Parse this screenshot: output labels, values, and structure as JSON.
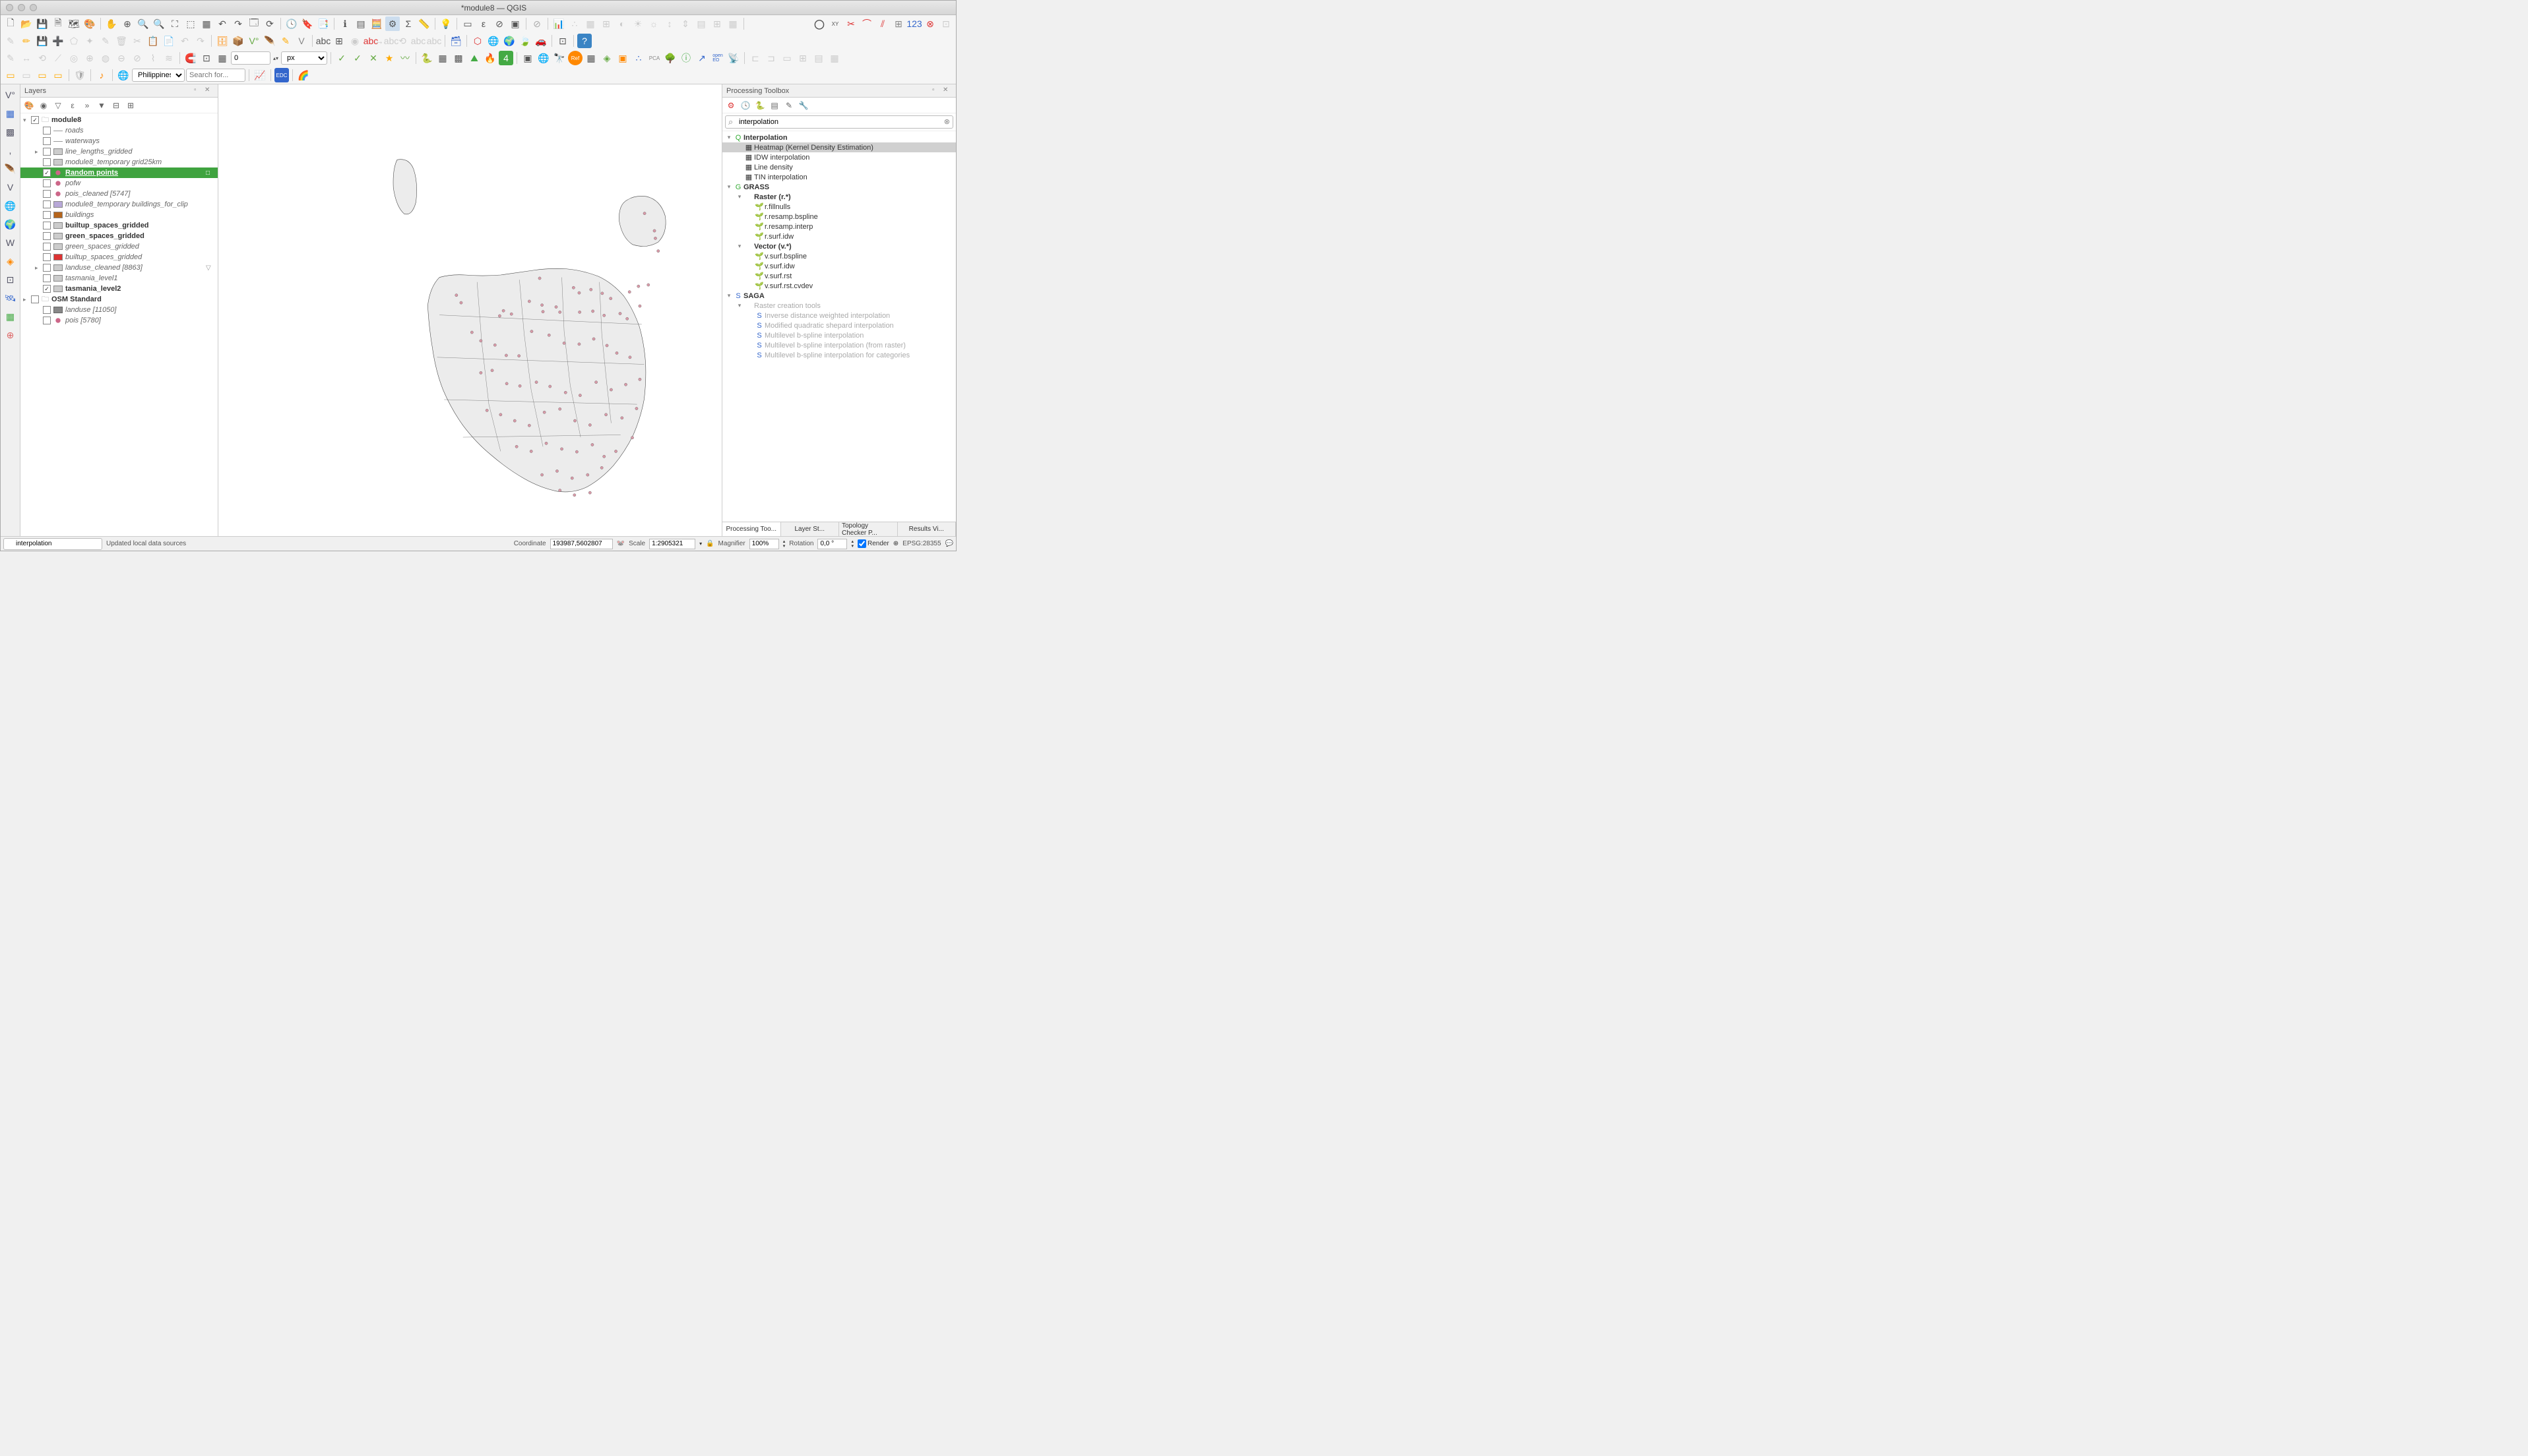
{
  "title": "*module8 — QGIS",
  "toolbar_row3": {
    "spin_value": "0",
    "unit": "px"
  },
  "toolbar_row4": {
    "region": "Philippines",
    "search_placeholder": "Search for..."
  },
  "layers_panel": {
    "title": "Layers",
    "items": [
      {
        "depth": 0,
        "exp": "▾",
        "checked": true,
        "icon": "group",
        "label": "module8",
        "bold": true
      },
      {
        "depth": 1,
        "exp": "",
        "checked": false,
        "icon": "line",
        "label": "roads",
        "italic": true
      },
      {
        "depth": 1,
        "exp": "",
        "checked": false,
        "icon": "line",
        "label": "waterways",
        "italic": true
      },
      {
        "depth": 1,
        "exp": "▸",
        "checked": false,
        "icon": "grid",
        "label": "line_lengths_gridded",
        "italic": true
      },
      {
        "depth": 1,
        "exp": "",
        "checked": false,
        "icon": "grid",
        "label": "module8_temporary grid25km",
        "italic": true
      },
      {
        "depth": 1,
        "exp": "",
        "checked": true,
        "icon": "point",
        "label": "Random points",
        "bold": true,
        "selected": true,
        "end": "□"
      },
      {
        "depth": 1,
        "exp": "",
        "checked": false,
        "icon": "dot",
        "label": "pofw",
        "italic": true
      },
      {
        "depth": 1,
        "exp": "",
        "checked": false,
        "icon": "dot",
        "label": "pois_cleaned [5747]",
        "italic": true
      },
      {
        "depth": 1,
        "exp": "",
        "checked": false,
        "icon": "purple",
        "label": "module8_temporary buildings_for_clip",
        "italic": true
      },
      {
        "depth": 1,
        "exp": "",
        "checked": false,
        "icon": "brown",
        "label": "buildings",
        "italic": true
      },
      {
        "depth": 1,
        "exp": "",
        "checked": false,
        "icon": "table",
        "label": "builtup_spaces_gridded",
        "bold": true
      },
      {
        "depth": 1,
        "exp": "",
        "checked": false,
        "icon": "table",
        "label": "green_spaces_gridded",
        "bold": true
      },
      {
        "depth": 1,
        "exp": "",
        "checked": false,
        "icon": "grid",
        "label": "green_spaces_gridded",
        "italic": true
      },
      {
        "depth": 1,
        "exp": "",
        "checked": false,
        "icon": "red",
        "label": "builtup_spaces_gridded",
        "italic": true
      },
      {
        "depth": 1,
        "exp": "▸",
        "checked": false,
        "icon": "grid",
        "label": "landuse_cleaned [8863]",
        "italic": true,
        "filter": "▽"
      },
      {
        "depth": 1,
        "exp": "",
        "checked": false,
        "icon": "poly",
        "label": "tasmania_level1",
        "italic": true
      },
      {
        "depth": 1,
        "exp": "",
        "checked": true,
        "icon": "poly",
        "label": "tasmania_level2",
        "bold": true
      },
      {
        "depth": 0,
        "exp": "▸",
        "checked": false,
        "icon": "group",
        "label": "OSM Standard",
        "bold": true
      },
      {
        "depth": 1,
        "exp": "",
        "checked": false,
        "icon": "grey",
        "label": "landuse [11050]",
        "italic": true
      },
      {
        "depth": 1,
        "exp": "",
        "checked": false,
        "icon": "dot",
        "label": "pois [5780]",
        "italic": true
      }
    ]
  },
  "processing_panel": {
    "title": "Processing Toolbox",
    "search_value": "interpolation",
    "tree": [
      {
        "depth": 0,
        "exp": "▾",
        "icon": "Q",
        "label": "Interpolation",
        "bold": true,
        "color": "#3a3"
      },
      {
        "depth": 1,
        "exp": "",
        "icon": "▦",
        "label": "Heatmap (Kernel Density Estimation)",
        "selected": true
      },
      {
        "depth": 1,
        "exp": "",
        "icon": "▦",
        "label": "IDW interpolation"
      },
      {
        "depth": 1,
        "exp": "",
        "icon": "▦",
        "label": "Line density"
      },
      {
        "depth": 1,
        "exp": "",
        "icon": "▦",
        "label": "TIN interpolation"
      },
      {
        "depth": 0,
        "exp": "▾",
        "icon": "G",
        "label": "GRASS",
        "bold": true,
        "color": "#3a3"
      },
      {
        "depth": 1,
        "exp": "▾",
        "icon": "",
        "label": "Raster (r.*)",
        "bold": true
      },
      {
        "depth": 2,
        "exp": "",
        "icon": "🌱",
        "label": "r.fillnulls"
      },
      {
        "depth": 2,
        "exp": "",
        "icon": "🌱",
        "label": "r.resamp.bspline"
      },
      {
        "depth": 2,
        "exp": "",
        "icon": "🌱",
        "label": "r.resamp.interp"
      },
      {
        "depth": 2,
        "exp": "",
        "icon": "🌱",
        "label": "r.surf.idw"
      },
      {
        "depth": 1,
        "exp": "▾",
        "icon": "",
        "label": "Vector (v.*)",
        "bold": true
      },
      {
        "depth": 2,
        "exp": "",
        "icon": "🌱",
        "label": "v.surf.bspline"
      },
      {
        "depth": 2,
        "exp": "",
        "icon": "🌱",
        "label": "v.surf.idw"
      },
      {
        "depth": 2,
        "exp": "",
        "icon": "🌱",
        "label": "v.surf.rst"
      },
      {
        "depth": 2,
        "exp": "",
        "icon": "🌱",
        "label": "v.surf.rst.cvdev"
      },
      {
        "depth": 0,
        "exp": "▾",
        "icon": "S",
        "label": "SAGA",
        "bold": true,
        "color": "#36c"
      },
      {
        "depth": 1,
        "exp": "▾",
        "icon": "",
        "label": "Raster creation tools",
        "disabled": true
      },
      {
        "depth": 2,
        "exp": "",
        "icon": "S",
        "label": "Inverse distance weighted interpolation",
        "disabled": true,
        "color": "#36c"
      },
      {
        "depth": 2,
        "exp": "",
        "icon": "S",
        "label": "Modified quadratic shepard interpolation",
        "disabled": true,
        "color": "#36c"
      },
      {
        "depth": 2,
        "exp": "",
        "icon": "S",
        "label": "Multilevel b-spline interpolation",
        "disabled": true,
        "color": "#36c"
      },
      {
        "depth": 2,
        "exp": "",
        "icon": "S",
        "label": "Multilevel b-spline interpolation (from raster)",
        "disabled": true,
        "color": "#36c"
      },
      {
        "depth": 2,
        "exp": "",
        "icon": "S",
        "label": "Multilevel b-spline interpolation for categories",
        "disabled": true,
        "color": "#36c"
      }
    ],
    "tabs": [
      "Processing Too...",
      "Layer St...",
      "Topology Checker P...",
      "Results Vi..."
    ]
  },
  "statusbar": {
    "search_value": "interpolation",
    "message": "Updated local data sources",
    "coord_label": "Coordinate",
    "coord_value": "193987,5602807",
    "scale_label": "Scale",
    "scale_value": "1:2905321",
    "mag_label": "Magnifier",
    "mag_value": "100%",
    "rot_label": "Rotation",
    "rot_value": "0,0 °",
    "render_label": "Render",
    "crs": "EPSG:28355"
  },
  "map_points": [
    [
      906,
      144
    ],
    [
      927,
      181
    ],
    [
      929,
      197
    ],
    [
      935,
      224
    ],
    [
      683,
      282
    ],
    [
      506,
      318
    ],
    [
      516,
      334
    ],
    [
      755,
      302
    ],
    [
      767,
      313
    ],
    [
      792,
      306
    ],
    [
      816,
      314
    ],
    [
      834,
      325
    ],
    [
      874,
      311
    ],
    [
      893,
      299
    ],
    [
      914,
      296
    ],
    [
      606,
      351
    ],
    [
      539,
      397
    ],
    [
      598,
      362
    ],
    [
      623,
      358
    ],
    [
      661,
      331
    ],
    [
      688,
      339
    ],
    [
      690,
      353
    ],
    [
      718,
      343
    ],
    [
      726,
      354
    ],
    [
      768,
      354
    ],
    [
      796,
      352
    ],
    [
      820,
      361
    ],
    [
      854,
      357
    ],
    [
      869,
      368
    ],
    [
      896,
      341
    ],
    [
      558,
      415
    ],
    [
      588,
      424
    ],
    [
      612,
      446
    ],
    [
      639,
      447
    ],
    [
      666,
      395
    ],
    [
      703,
      403
    ],
    [
      735,
      420
    ],
    [
      767,
      422
    ],
    [
      798,
      411
    ],
    [
      826,
      425
    ],
    [
      847,
      441
    ],
    [
      875,
      450
    ],
    [
      558,
      483
    ],
    [
      582,
      478
    ],
    [
      613,
      506
    ],
    [
      641,
      511
    ],
    [
      676,
      503
    ],
    [
      705,
      512
    ],
    [
      738,
      525
    ],
    [
      769,
      531
    ],
    [
      803,
      503
    ],
    [
      835,
      519
    ],
    [
      866,
      508
    ],
    [
      896,
      497
    ],
    [
      571,
      563
    ],
    [
      600,
      572
    ],
    [
      630,
      585
    ],
    [
      661,
      595
    ],
    [
      693,
      567
    ],
    [
      726,
      560
    ],
    [
      758,
      585
    ],
    [
      790,
      594
    ],
    [
      824,
      572
    ],
    [
      858,
      579
    ],
    [
      889,
      559
    ],
    [
      634,
      640
    ],
    [
      665,
      650
    ],
    [
      697,
      633
    ],
    [
      730,
      645
    ],
    [
      762,
      651
    ],
    [
      795,
      636
    ],
    [
      820,
      661
    ],
    [
      845,
      650
    ],
    [
      880,
      621
    ],
    [
      688,
      700
    ],
    [
      720,
      692
    ],
    [
      752,
      707
    ],
    [
      785,
      700
    ],
    [
      815,
      685
    ],
    [
      726,
      733
    ],
    [
      757,
      743
    ],
    [
      790,
      738
    ]
  ]
}
